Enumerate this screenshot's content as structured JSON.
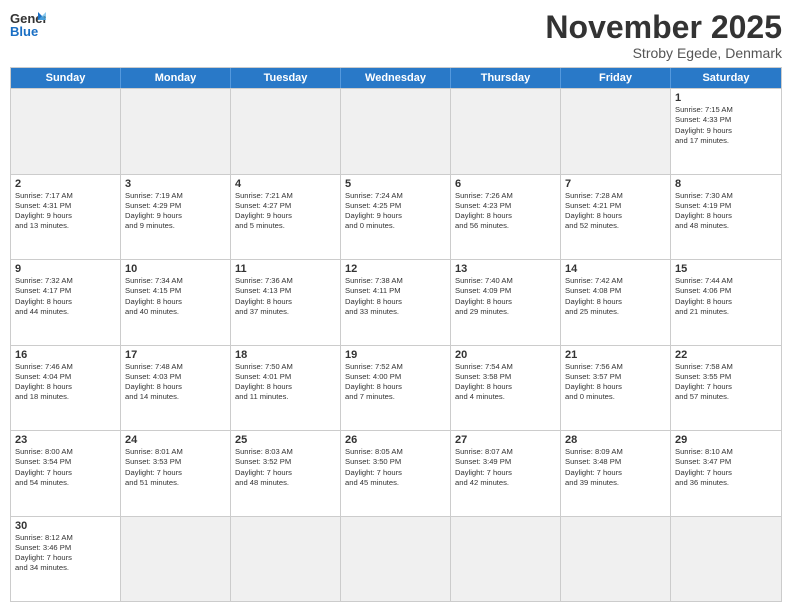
{
  "logo": {
    "general": "General",
    "blue": "Blue"
  },
  "title": "November 2025",
  "subtitle": "Stroby Egede, Denmark",
  "weekdays": [
    "Sunday",
    "Monday",
    "Tuesday",
    "Wednesday",
    "Thursday",
    "Friday",
    "Saturday"
  ],
  "rows": [
    [
      {
        "day": "",
        "text": "",
        "empty": true
      },
      {
        "day": "",
        "text": "",
        "empty": true
      },
      {
        "day": "",
        "text": "",
        "empty": true
      },
      {
        "day": "",
        "text": "",
        "empty": true
      },
      {
        "day": "",
        "text": "",
        "empty": true
      },
      {
        "day": "",
        "text": "",
        "empty": true
      },
      {
        "day": "1",
        "text": "Sunrise: 7:15 AM\nSunset: 4:33 PM\nDaylight: 9 hours\nand 17 minutes.",
        "empty": false
      }
    ],
    [
      {
        "day": "2",
        "text": "Sunrise: 7:17 AM\nSunset: 4:31 PM\nDaylight: 9 hours\nand 13 minutes.",
        "empty": false
      },
      {
        "day": "3",
        "text": "Sunrise: 7:19 AM\nSunset: 4:29 PM\nDaylight: 9 hours\nand 9 minutes.",
        "empty": false
      },
      {
        "day": "4",
        "text": "Sunrise: 7:21 AM\nSunset: 4:27 PM\nDaylight: 9 hours\nand 5 minutes.",
        "empty": false
      },
      {
        "day": "5",
        "text": "Sunrise: 7:24 AM\nSunset: 4:25 PM\nDaylight: 9 hours\nand 0 minutes.",
        "empty": false
      },
      {
        "day": "6",
        "text": "Sunrise: 7:26 AM\nSunset: 4:23 PM\nDaylight: 8 hours\nand 56 minutes.",
        "empty": false
      },
      {
        "day": "7",
        "text": "Sunrise: 7:28 AM\nSunset: 4:21 PM\nDaylight: 8 hours\nand 52 minutes.",
        "empty": false
      },
      {
        "day": "8",
        "text": "Sunrise: 7:30 AM\nSunset: 4:19 PM\nDaylight: 8 hours\nand 48 minutes.",
        "empty": false
      }
    ],
    [
      {
        "day": "9",
        "text": "Sunrise: 7:32 AM\nSunset: 4:17 PM\nDaylight: 8 hours\nand 44 minutes.",
        "empty": false
      },
      {
        "day": "10",
        "text": "Sunrise: 7:34 AM\nSunset: 4:15 PM\nDaylight: 8 hours\nand 40 minutes.",
        "empty": false
      },
      {
        "day": "11",
        "text": "Sunrise: 7:36 AM\nSunset: 4:13 PM\nDaylight: 8 hours\nand 37 minutes.",
        "empty": false
      },
      {
        "day": "12",
        "text": "Sunrise: 7:38 AM\nSunset: 4:11 PM\nDaylight: 8 hours\nand 33 minutes.",
        "empty": false
      },
      {
        "day": "13",
        "text": "Sunrise: 7:40 AM\nSunset: 4:09 PM\nDaylight: 8 hours\nand 29 minutes.",
        "empty": false
      },
      {
        "day": "14",
        "text": "Sunrise: 7:42 AM\nSunset: 4:08 PM\nDaylight: 8 hours\nand 25 minutes.",
        "empty": false
      },
      {
        "day": "15",
        "text": "Sunrise: 7:44 AM\nSunset: 4:06 PM\nDaylight: 8 hours\nand 21 minutes.",
        "empty": false
      }
    ],
    [
      {
        "day": "16",
        "text": "Sunrise: 7:46 AM\nSunset: 4:04 PM\nDaylight: 8 hours\nand 18 minutes.",
        "empty": false
      },
      {
        "day": "17",
        "text": "Sunrise: 7:48 AM\nSunset: 4:03 PM\nDaylight: 8 hours\nand 14 minutes.",
        "empty": false
      },
      {
        "day": "18",
        "text": "Sunrise: 7:50 AM\nSunset: 4:01 PM\nDaylight: 8 hours\nand 11 minutes.",
        "empty": false
      },
      {
        "day": "19",
        "text": "Sunrise: 7:52 AM\nSunset: 4:00 PM\nDaylight: 8 hours\nand 7 minutes.",
        "empty": false
      },
      {
        "day": "20",
        "text": "Sunrise: 7:54 AM\nSunset: 3:58 PM\nDaylight: 8 hours\nand 4 minutes.",
        "empty": false
      },
      {
        "day": "21",
        "text": "Sunrise: 7:56 AM\nSunset: 3:57 PM\nDaylight: 8 hours\nand 0 minutes.",
        "empty": false
      },
      {
        "day": "22",
        "text": "Sunrise: 7:58 AM\nSunset: 3:55 PM\nDaylight: 7 hours\nand 57 minutes.",
        "empty": false
      }
    ],
    [
      {
        "day": "23",
        "text": "Sunrise: 8:00 AM\nSunset: 3:54 PM\nDaylight: 7 hours\nand 54 minutes.",
        "empty": false
      },
      {
        "day": "24",
        "text": "Sunrise: 8:01 AM\nSunset: 3:53 PM\nDaylight: 7 hours\nand 51 minutes.",
        "empty": false
      },
      {
        "day": "25",
        "text": "Sunrise: 8:03 AM\nSunset: 3:52 PM\nDaylight: 7 hours\nand 48 minutes.",
        "empty": false
      },
      {
        "day": "26",
        "text": "Sunrise: 8:05 AM\nSunset: 3:50 PM\nDaylight: 7 hours\nand 45 minutes.",
        "empty": false
      },
      {
        "day": "27",
        "text": "Sunrise: 8:07 AM\nSunset: 3:49 PM\nDaylight: 7 hours\nand 42 minutes.",
        "empty": false
      },
      {
        "day": "28",
        "text": "Sunrise: 8:09 AM\nSunset: 3:48 PM\nDaylight: 7 hours\nand 39 minutes.",
        "empty": false
      },
      {
        "day": "29",
        "text": "Sunrise: 8:10 AM\nSunset: 3:47 PM\nDaylight: 7 hours\nand 36 minutes.",
        "empty": false
      }
    ],
    [
      {
        "day": "30",
        "text": "Sunrise: 8:12 AM\nSunset: 3:46 PM\nDaylight: 7 hours\nand 34 minutes.",
        "empty": false
      },
      {
        "day": "",
        "text": "",
        "empty": true
      },
      {
        "day": "",
        "text": "",
        "empty": true
      },
      {
        "day": "",
        "text": "",
        "empty": true
      },
      {
        "day": "",
        "text": "",
        "empty": true
      },
      {
        "day": "",
        "text": "",
        "empty": true
      },
      {
        "day": "",
        "text": "",
        "empty": true
      }
    ]
  ]
}
